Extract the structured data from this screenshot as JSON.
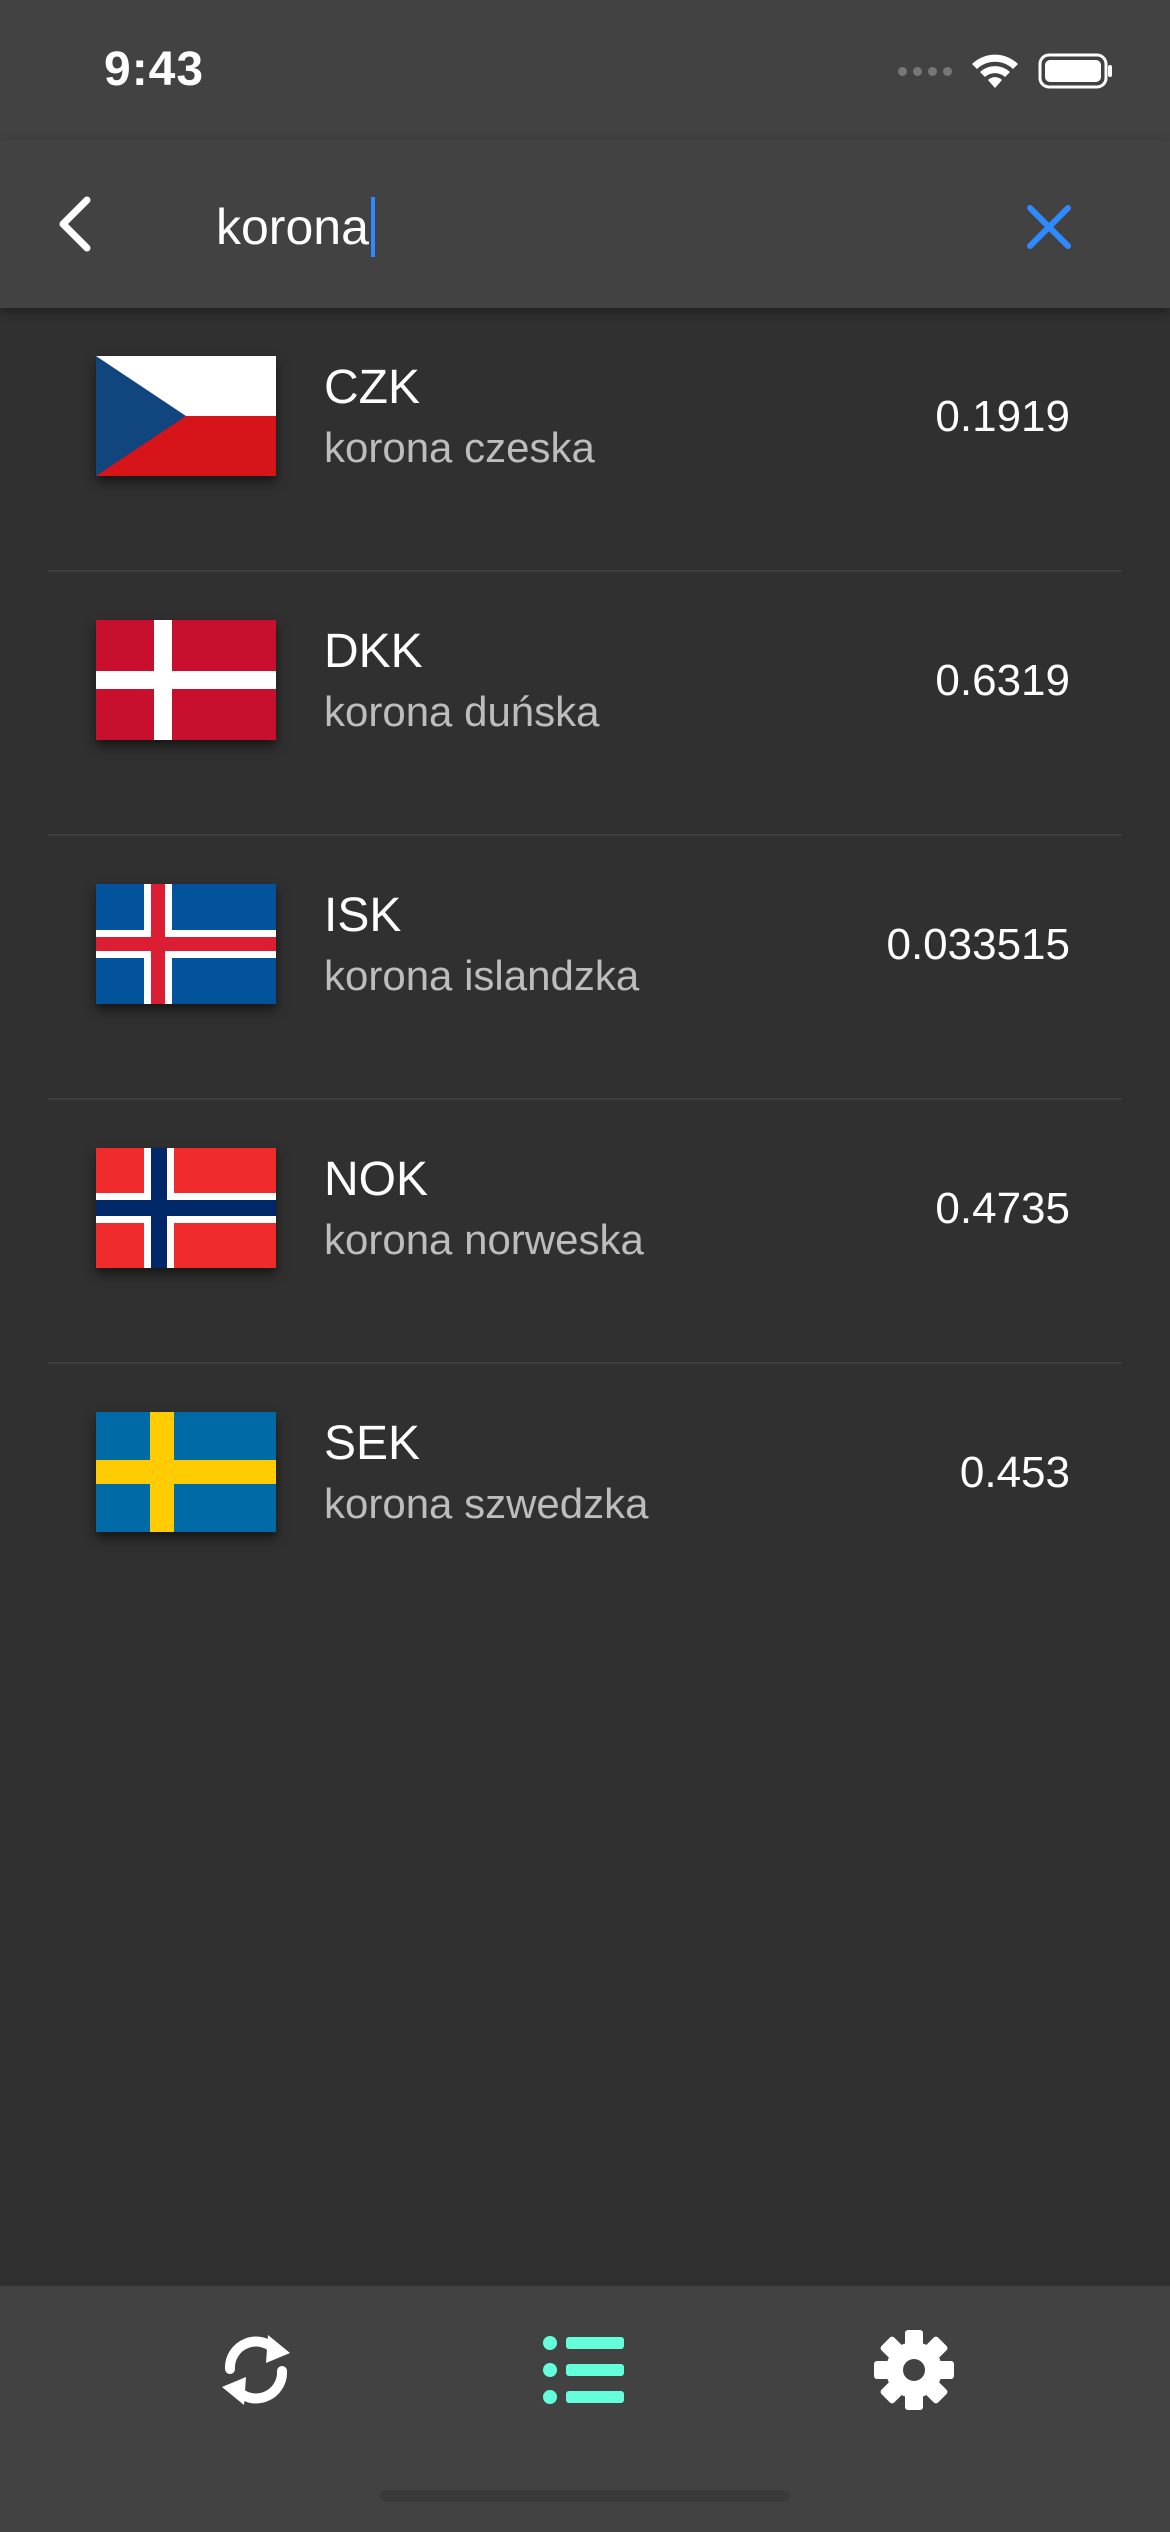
{
  "status_bar": {
    "time": "9:43"
  },
  "search": {
    "value": "korona",
    "back_icon": "chevron-left-icon",
    "clear_icon": "close-icon",
    "accent_color": "#2e8bff"
  },
  "currencies": [
    {
      "code": "CZK",
      "name": "korona czeska",
      "rate": "0.1919",
      "flag": "flag-czech-icon"
    },
    {
      "code": "DKK",
      "name": "korona duńska",
      "rate": "0.6319",
      "flag": "flag-denmark-icon"
    },
    {
      "code": "ISK",
      "name": "korona islandzka",
      "rate": "0.033515",
      "flag": "flag-iceland-icon"
    },
    {
      "code": "NOK",
      "name": "korona norweska",
      "rate": "0.4735",
      "flag": "flag-norway-icon"
    },
    {
      "code": "SEK",
      "name": "korona szwedzka",
      "rate": "0.453",
      "flag": "flag-sweden-icon"
    }
  ],
  "bottom_nav": {
    "items": [
      {
        "icon": "refresh-icon",
        "active": false
      },
      {
        "icon": "list-icon",
        "active": true
      },
      {
        "icon": "gear-icon",
        "active": false
      }
    ],
    "active_color": "#64ffda",
    "inactive_color": "#ffffff"
  }
}
